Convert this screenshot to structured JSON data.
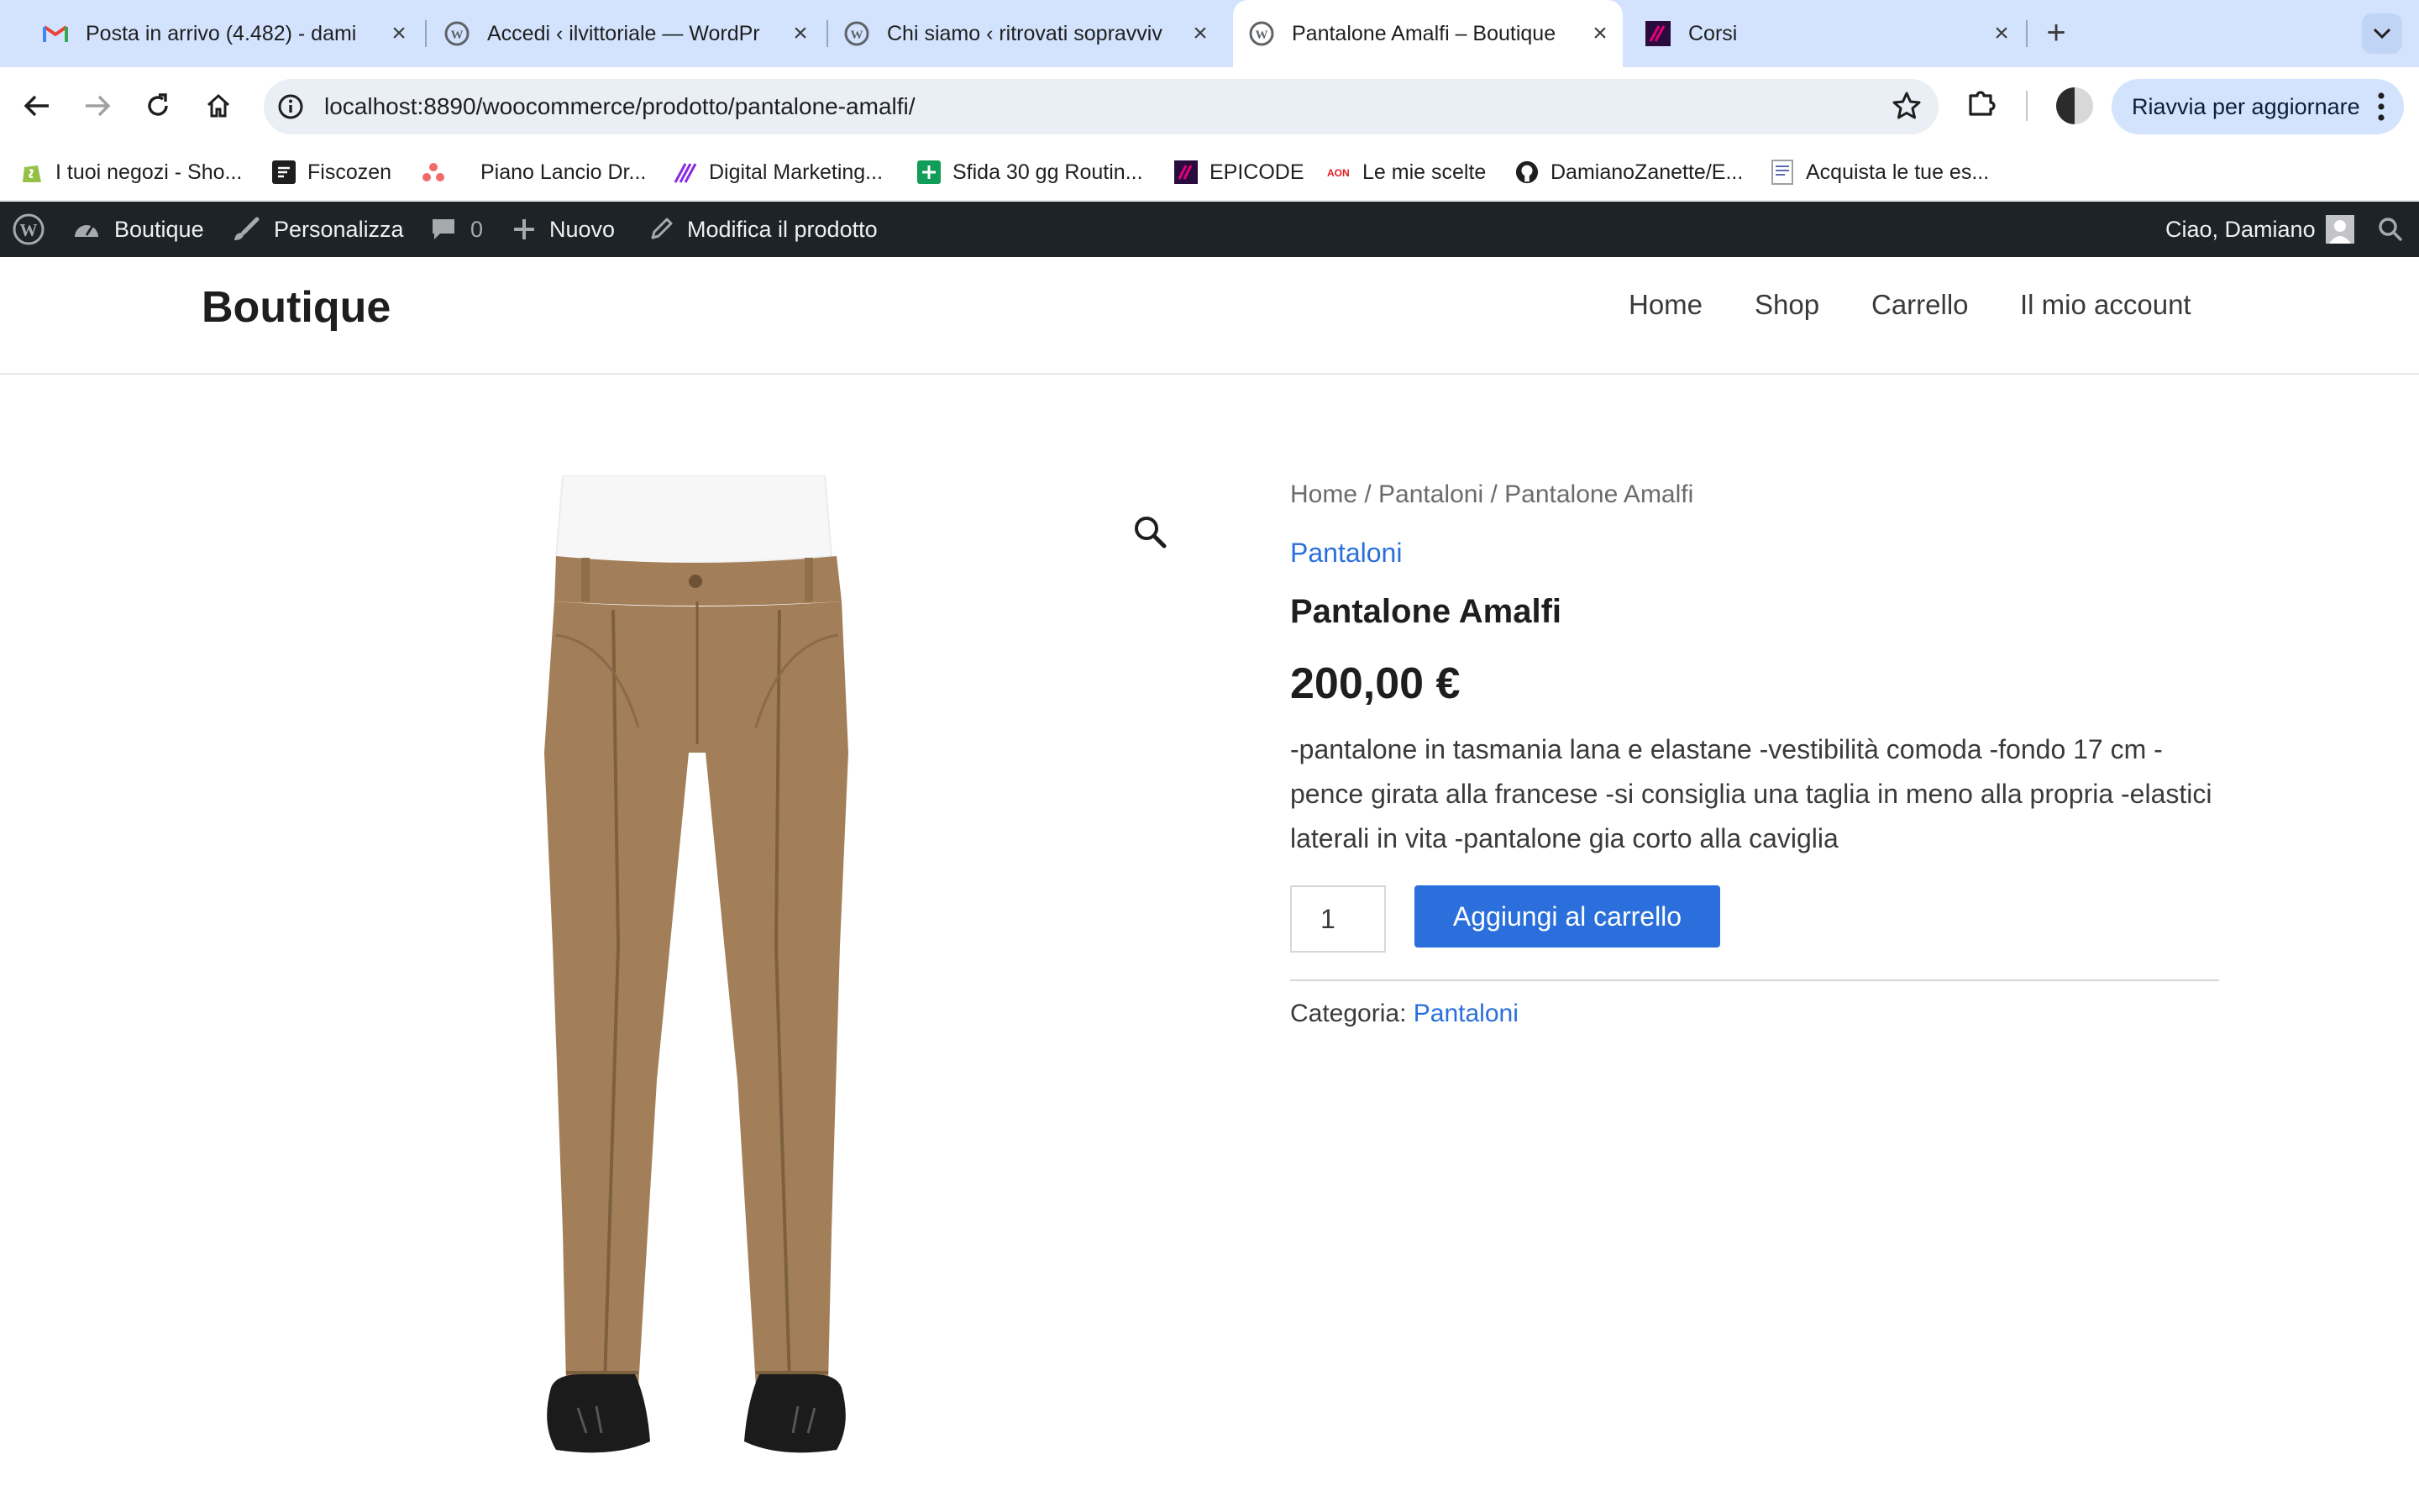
{
  "browser": {
    "tabs": [
      {
        "title": "Posta in arrivo (4.482) - dami",
        "icon": "gmail-icon"
      },
      {
        "title": "Accedi ‹ ilvittoriale — WordPr",
        "icon": "wordpress-icon"
      },
      {
        "title": "Chi siamo ‹ ritrovati sopravviv",
        "icon": "wordpress-icon"
      },
      {
        "title": "Pantalone Amalfi – Boutique",
        "icon": "wordpress-icon",
        "active": true
      },
      {
        "title": "Corsi",
        "icon": "epicode-icon"
      }
    ],
    "url": "localhost:8890/woocommerce/prodotto/pantalone-amalfi/",
    "restart_label": "Riavvia per aggiornare",
    "bookmarks": [
      {
        "label": "I tuoi negozi - Sho...",
        "icon": "shopify-icon"
      },
      {
        "label": "Fiscozen",
        "icon": "fiscozen-icon"
      },
      {
        "label": "Piano Lancio Dr...",
        "icon": "asana-icon"
      },
      {
        "label": "Digital Marketing...",
        "icon": "stripes-icon"
      },
      {
        "label": "Sfida 30 gg Routin...",
        "icon": "sheets-icon"
      },
      {
        "label": "EPICODE",
        "icon": "epicode-icon"
      },
      {
        "label": "Le mie scelte",
        "icon": "aon-icon"
      },
      {
        "label": "DamianoZanette/E...",
        "icon": "github-icon"
      },
      {
        "label": "Acquista le tue es...",
        "icon": "doc-icon"
      }
    ]
  },
  "adminbar": {
    "site": "Boutique",
    "customize": "Personalizza",
    "comments": "0",
    "new": "Nuovo",
    "edit": "Modifica il prodotto",
    "greeting": "Ciao, Damiano"
  },
  "site": {
    "logo": "Boutique",
    "nav": [
      "Home",
      "Shop",
      "Carrello",
      "Il mio account"
    ]
  },
  "product": {
    "breadcrumb": "Home / Pantaloni / Pantalone Amalfi",
    "category": "Pantaloni",
    "title": "Pantalone Amalfi",
    "price": "200,00 €",
    "description": "-pantalone in tasmania lana e elastane -vestibilità comoda -fondo 17 cm -pence girata alla francese -si consiglia una taglia in meno alla propria -elastici laterali in vita -pantalone gia corto alla caviglia",
    "quantity": "1",
    "add_to_cart": "Aggiungi al carrello",
    "meta_label": "Categoria:",
    "meta_category": "Pantaloni"
  },
  "colors": {
    "accent": "#2a6fdb",
    "adminbar": "#1d2327",
    "tabstrip": "#d3e3fd",
    "trousers": "#a27f59"
  }
}
